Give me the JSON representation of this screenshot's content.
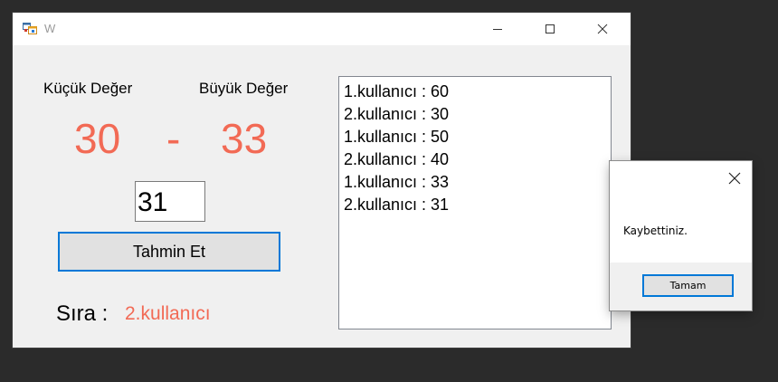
{
  "window": {
    "title": "W",
    "icons": {
      "app": "form-app-icon",
      "minimize": "minimize-icon",
      "maximize": "maximize-icon",
      "close": "close-icon"
    }
  },
  "form": {
    "min_label": "Küçük Değer",
    "max_label": "Büyük Değer",
    "min_value": "30",
    "separator": "-",
    "max_value": "33",
    "guess_value": "31",
    "guess_button": "Tahmin Et",
    "turn_label": "Sıra :",
    "turn_value": "2.kullanıcı"
  },
  "history": [
    "1.kullanıcı : 60",
    "2.kullanıcı : 30",
    "1.kullanıcı : 50",
    "2.kullanıcı : 40",
    "1.kullanıcı : 33",
    "2.kullanıcı : 31"
  ],
  "message_box": {
    "text": "Kaybettiniz.",
    "ok_button": "Tamam"
  },
  "colors": {
    "accent_red": "#f26a55",
    "focus_blue": "#0078d7"
  }
}
